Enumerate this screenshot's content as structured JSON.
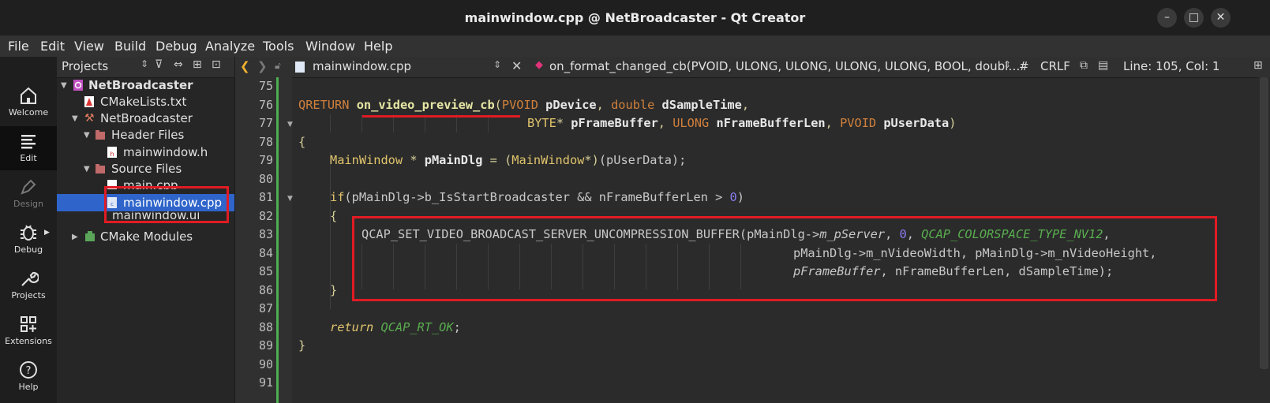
{
  "window": {
    "title": "mainwindow.cpp @ NetBroadcaster - Qt Creator",
    "minimize_glyph": "–",
    "maximize_glyph": "□",
    "close_glyph": "✕"
  },
  "menu": [
    {
      "label": "File"
    },
    {
      "label": "Edit"
    },
    {
      "label": "View"
    },
    {
      "label": "Build"
    },
    {
      "label": "Debug"
    },
    {
      "label": "Analyze"
    },
    {
      "label": "Tools"
    },
    {
      "label": "Window"
    },
    {
      "label": "Help"
    }
  ],
  "modes": [
    {
      "label": "Welcome",
      "icon": "home-icon",
      "active": false,
      "enabled": true
    },
    {
      "label": "Edit",
      "icon": "edit-icon",
      "active": true,
      "enabled": true
    },
    {
      "label": "Design",
      "icon": "pen-icon",
      "active": false,
      "enabled": false
    },
    {
      "label": "Debug",
      "icon": "bug-icon",
      "active": false,
      "enabled": true
    },
    {
      "label": "Projects",
      "icon": "wrench-icon",
      "active": false,
      "enabled": true
    },
    {
      "label": "Extensions",
      "icon": "grid-plus-icon",
      "active": false,
      "enabled": true
    },
    {
      "label": "Help",
      "icon": "question-icon",
      "active": false,
      "enabled": true
    }
  ],
  "projects": {
    "header": "Projects",
    "tree": [
      {
        "label": "NetBroadcaster",
        "level": 0,
        "bold": true
      },
      {
        "label": "CMakeLists.txt",
        "level": 1
      },
      {
        "label": "NetBroadcaster",
        "level": 1
      },
      {
        "label": "Header Files",
        "level": 2
      },
      {
        "label": "mainwindow.h",
        "level": 3
      },
      {
        "label": "Source Files",
        "level": 2
      },
      {
        "label": "main.cpp",
        "level": 3
      },
      {
        "label": "mainwindow.cpp",
        "level": 3,
        "selected": true
      },
      {
        "label": "mainwindow.ui",
        "level": 3
      },
      {
        "label": "CMake Modules",
        "level": 1
      }
    ]
  },
  "editor": {
    "file_tab": "mainwindow.cpp",
    "symbol": "on_format_changed_cb(PVOID, ULONG, ULONG, ULONG, ULONG, BOOL, doubl…",
    "hash": "#",
    "line_ending": "CRLF",
    "cursor": "Line: 105, Col: 1",
    "line_numbers": [
      "75",
      "76",
      "77",
      "78",
      "79",
      "80",
      "81",
      "82",
      "83",
      "84",
      "85",
      "86",
      "87",
      "88",
      "89",
      "90",
      "91"
    ],
    "code": {
      "l76_ret": "QRETURN",
      "l76_fn": "on_video_preview_cb",
      "l76_p1t": "PVOID",
      "l76_p1": "pDevice",
      "l76_p2t": "double",
      "l76_p2": "dSampleTime",
      "l77_p3t": "BYTE",
      "l77_p3": "pFrameBuffer",
      "l77_p4t": "ULONG",
      "l77_p4": "nFrameBufferLen",
      "l77_p5t": "PVOID",
      "l77_p5": "pUserData",
      "l78": "{",
      "l79_t": "MainWindow",
      "l79_v": "pMainDlg",
      "l79_c": "MainWindow",
      "l79_arg": "(pUserData);",
      "l81_if": "if",
      "l81_cond": "(pMainDlg->b_IsStartBroadcaster && nFrameBufferLen > ",
      "l81_zero": "0",
      "l81_end": ")",
      "l82": "{",
      "l83_fn": "QCAP_SET_VIDEO_BROADCAST_SERVER_UNCOMPRESSION_BUFFER",
      "l83_a1": "(pMainDlg->",
      "l83_m": "m_pServer",
      "l83_zero": "0",
      "l83_const": "QCAP_COLORSPACE_TYPE_NV12",
      "l84": "pMainDlg->m_nVideoWidth, pMainDlg->m_nVideoHeight,",
      "l85_a": "pFrameBuffer",
      "l85_b": ", nFrameBufferLen, dSampleTime);",
      "l86": "}",
      "l88_ret": "return",
      "l88_val": "QCAP_RT_OK",
      "l89": "}"
    }
  },
  "colors": {
    "highlight_red": "#e01b24",
    "selection_blue": "#2f65ca",
    "modified_green": "#4caf50"
  }
}
